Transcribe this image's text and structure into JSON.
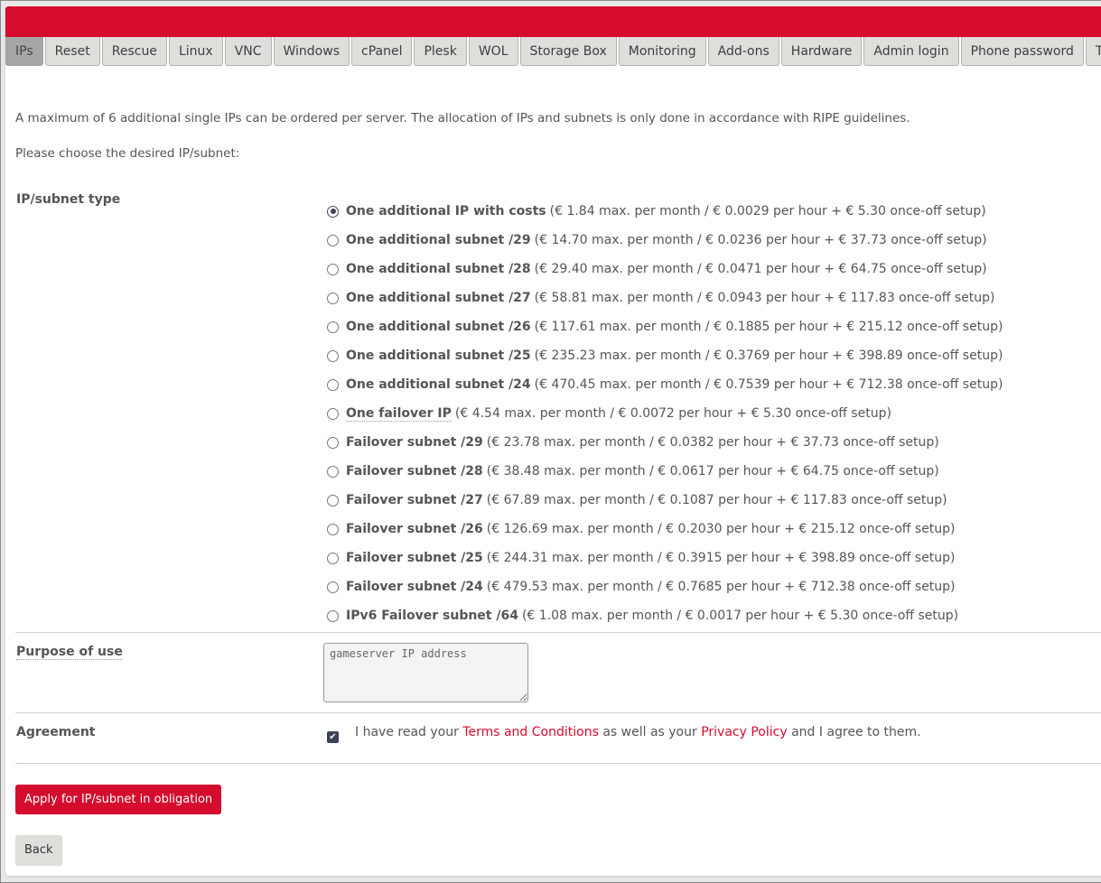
{
  "tabs": [
    {
      "label": "IPs",
      "active": true
    },
    {
      "label": "Reset"
    },
    {
      "label": "Rescue"
    },
    {
      "label": "Linux"
    },
    {
      "label": "VNC"
    },
    {
      "label": "Windows"
    },
    {
      "label": "cPanel"
    },
    {
      "label": "Plesk"
    },
    {
      "label": "WOL"
    },
    {
      "label": "Storage Box"
    },
    {
      "label": "Monitoring"
    },
    {
      "label": "Add-ons"
    },
    {
      "label": "Hardware"
    },
    {
      "label": "Admin login"
    },
    {
      "label": "Phone password"
    },
    {
      "label": "Transfer"
    }
  ],
  "intro": {
    "line1": "A maximum of 6 additional single IPs can be ordered per server. The allocation of IPs and subnets is only done in accordance with RIPE guidelines.",
    "line2": "Please choose the desired IP/subnet:"
  },
  "form": {
    "type_label": "IP/subnet type",
    "options": [
      {
        "name": "One additional IP with costs",
        "desc": "(€ 1.84 max. per month / € 0.0029 per hour + € 5.30 once-off setup)",
        "checked": true
      },
      {
        "name": "One additional subnet /29",
        "desc": "(€ 14.70 max. per month / € 0.0236 per hour + € 37.73 once-off setup)"
      },
      {
        "name": "One additional subnet /28",
        "desc": "(€ 29.40 max. per month / € 0.0471 per hour + € 64.75 once-off setup)"
      },
      {
        "name": "One additional subnet /27",
        "desc": "(€ 58.81 max. per month / € 0.0943 per hour + € 117.83 once-off setup)"
      },
      {
        "name": "One additional subnet /26",
        "desc": "(€ 117.61 max. per month / € 0.1885 per hour + € 215.12 once-off setup)"
      },
      {
        "name": "One additional subnet /25",
        "desc": "(€ 235.23 max. per month / € 0.3769 per hour + € 398.89 once-off setup)"
      },
      {
        "name": "One additional subnet /24",
        "desc": "(€ 470.45 max. per month / € 0.7539 per hour + € 712.38 once-off setup)"
      },
      {
        "name": "One failover IP",
        "desc": "(€ 4.54 max. per month / € 0.0072 per hour + € 5.30 once-off setup)",
        "tooltip": true
      },
      {
        "name": "Failover subnet /29",
        "desc": "(€ 23.78 max. per month / € 0.0382 per hour + € 37.73 once-off setup)"
      },
      {
        "name": "Failover subnet /28",
        "desc": "(€ 38.48 max. per month / € 0.0617 per hour + € 64.75 once-off setup)"
      },
      {
        "name": "Failover subnet /27",
        "desc": "(€ 67.89 max. per month / € 0.1087 per hour + € 117.83 once-off setup)"
      },
      {
        "name": "Failover subnet /26",
        "desc": "(€ 126.69 max. per month / € 0.2030 per hour + € 215.12 once-off setup)"
      },
      {
        "name": "Failover subnet /25",
        "desc": "(€ 244.31 max. per month / € 0.3915 per hour + € 398.89 once-off setup)"
      },
      {
        "name": "Failover subnet /24",
        "desc": "(€ 479.53 max. per month / € 0.7685 per hour + € 712.38 once-off setup)"
      },
      {
        "name": "IPv6 Failover subnet /64",
        "desc": "(€ 1.08 max. per month / € 0.0017 per hour + € 5.30 once-off setup)"
      }
    ],
    "purpose_label": "Purpose of use",
    "purpose_value": "gameserver IP address",
    "agreement_label": "Agreement",
    "agreement": {
      "checked": true,
      "text_before": "I have read your ",
      "terms_link": "Terms and Conditions",
      "text_middle": " as well as your ",
      "privacy_link": "Privacy Policy",
      "text_after": " and I agree to them."
    }
  },
  "buttons": {
    "apply": "Apply for IP/subnet in obligation",
    "back": "Back"
  },
  "colors": {
    "brand_red": "#d50c2d",
    "tab_bg": "#e0dedb",
    "tab_active_bg": "#a6a6a6"
  }
}
